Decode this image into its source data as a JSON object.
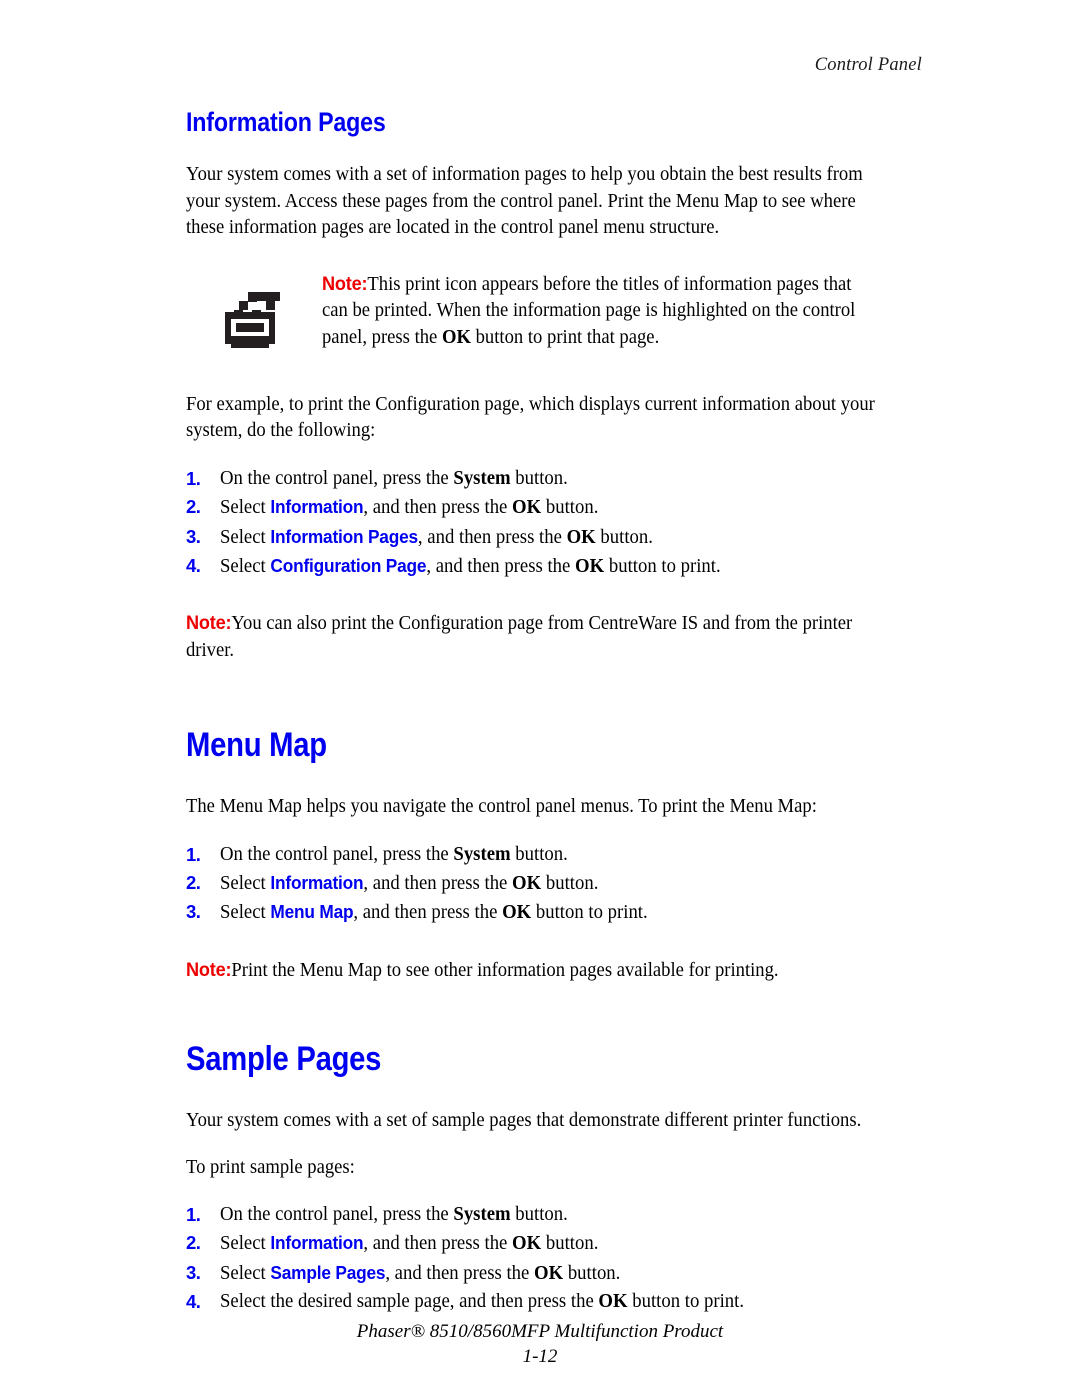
{
  "header": {
    "running_title": "Control Panel"
  },
  "sections": [
    {
      "id": "information-pages",
      "heading": "Information Pages",
      "heading_level": "h2",
      "intro": "Your system comes with a set of information pages to help you obtain the best results from your system. Access these pages from the control panel. Print the Menu Map to see where these information pages are located in the control panel menu structure.",
      "icon_note": {
        "icon": "printer-icon",
        "label": "Note:",
        "text_part_1": "This print icon appears before the titles of information pages that can be printed. When the information page is highlighted on the control panel, press the ",
        "ui_term": "OK",
        "text_part_2": " button to print that page."
      },
      "lead_in": "For example, to print the Configuration page, which displays current information about your system, do the following:",
      "steps": [
        {
          "number": "1.",
          "prefix": "On the control panel, press the ",
          "term": "System",
          "term_style": "ui-bold",
          "suffix": " button."
        },
        {
          "number": "2.",
          "prefix": "Select ",
          "term": "Information",
          "term_style": "menu-term",
          "mid": ", and then press the ",
          "ui_term": "OK",
          "suffix": " button."
        },
        {
          "number": "3.",
          "prefix": "Select ",
          "term": "Information Pages",
          "term_style": "menu-term",
          "mid": ", and then press the ",
          "ui_term": "OK",
          "suffix": " button."
        },
        {
          "number": "4.",
          "prefix": "Select ",
          "term": "Configuration Page",
          "term_style": "menu-term",
          "mid": ", and then press the ",
          "ui_term": "OK",
          "suffix": " button to print."
        }
      ],
      "closing_note": {
        "label": "Note:",
        "text": "You can also print the Configuration page from CentreWare IS and from the printer driver."
      }
    },
    {
      "id": "menu-map",
      "heading": "Menu Map",
      "heading_level": "h1",
      "intro": "The Menu Map helps you navigate the control panel menus. To print the Menu Map:",
      "steps": [
        {
          "number": "1.",
          "prefix": "On the control panel, press the ",
          "term": "System",
          "term_style": "ui-bold",
          "suffix": " button."
        },
        {
          "number": "2.",
          "prefix": "Select ",
          "term": "Information",
          "term_style": "menu-term",
          "mid": ", and then press the ",
          "ui_term": "OK",
          "suffix": " button."
        },
        {
          "number": "3.",
          "prefix": "Select ",
          "term": "Menu Map",
          "term_style": "menu-term",
          "mid": ", and then press the ",
          "ui_term": "OK",
          "suffix": " button to print."
        }
      ],
      "closing_note": {
        "label": "Note:",
        "text": "Print the Menu Map to see other information pages available for printing."
      }
    },
    {
      "id": "sample-pages",
      "heading": "Sample Pages",
      "heading_level": "h1",
      "intro": "Your system comes with a set of sample pages that demonstrate different printer functions.",
      "lead_in": "To print sample pages:",
      "steps": [
        {
          "number": "1.",
          "prefix": "On the control panel, press the ",
          "term": "System",
          "term_style": "ui-bold",
          "suffix": " button."
        },
        {
          "number": "2.",
          "prefix": "Select ",
          "term": "Information",
          "term_style": "menu-term",
          "mid": ", and then press the ",
          "ui_term": "OK",
          "suffix": " button."
        },
        {
          "number": "3.",
          "prefix": "Select ",
          "term": "Sample Pages",
          "term_style": "menu-term",
          "mid": ", and then press the ",
          "ui_term": "OK",
          "suffix": " button."
        },
        {
          "number": "4.",
          "prefix": "Select the desired sample page, and then press the ",
          "term": "OK",
          "term_style": "ui-bold",
          "suffix": " button to print."
        }
      ]
    }
  ],
  "footer": {
    "product": "Phaser® 8510/8560MFP Multifunction Product",
    "page_number": "1-12"
  },
  "colors": {
    "heading_blue": "#0000f0",
    "note_red": "#ee0000",
    "body_black": "#000000",
    "icon_black": "#231f20"
  }
}
